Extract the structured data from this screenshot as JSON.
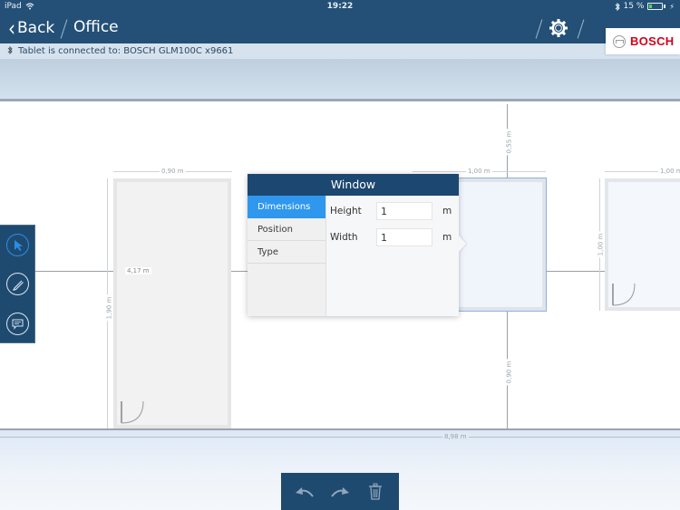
{
  "status_bar": {
    "device": "iPad",
    "time": "19:22",
    "battery_percent": "15 %",
    "wifi_icon": "wifi-icon",
    "bluetooth_icon": "bluetooth-icon",
    "battery_icon": "battery-icon"
  },
  "nav": {
    "back_label": "Back",
    "title": "Office",
    "settings_icon": "gear-icon"
  },
  "brand": {
    "name": "BOSCH",
    "color": "#d0021b"
  },
  "connection": {
    "text": "Tablet is connected to: BOSCH GLM100C x9661",
    "icon": "bluetooth-icon"
  },
  "tools": [
    {
      "name": "select",
      "icon": "cursor-arrow-icon",
      "active": true
    },
    {
      "name": "draw",
      "icon": "pencil-icon",
      "active": false
    },
    {
      "name": "comment",
      "icon": "comment-icon",
      "active": false
    }
  ],
  "canvas": {
    "dimensions": {
      "door_width": "0,90 m",
      "door_height": "1,90 m",
      "offset_left": "4,17 m",
      "window_width": "1,00 m",
      "window_top_offset": "0,55 m",
      "window_bottom_offset": "0,90 m",
      "right_width": "1,00 m",
      "right_height": "1,00 m",
      "wall_length": "8,98 m"
    }
  },
  "popup": {
    "title": "Window",
    "tabs": [
      {
        "label": "Dimensions",
        "active": true
      },
      {
        "label": "Position",
        "active": false
      },
      {
        "label": "Type",
        "active": false
      }
    ],
    "fields": [
      {
        "label": "Height",
        "value": "1",
        "unit": "m"
      },
      {
        "label": "Width",
        "value": "1",
        "unit": "m"
      }
    ]
  },
  "bottom_toolbar": {
    "buttons": [
      {
        "name": "undo",
        "icon": "undo-icon"
      },
      {
        "name": "redo",
        "icon": "redo-icon"
      },
      {
        "name": "delete",
        "icon": "trash-icon"
      }
    ]
  },
  "colors": {
    "header": "#245077",
    "accent": "#2f97ee",
    "panel_dark": "#1c4770"
  }
}
